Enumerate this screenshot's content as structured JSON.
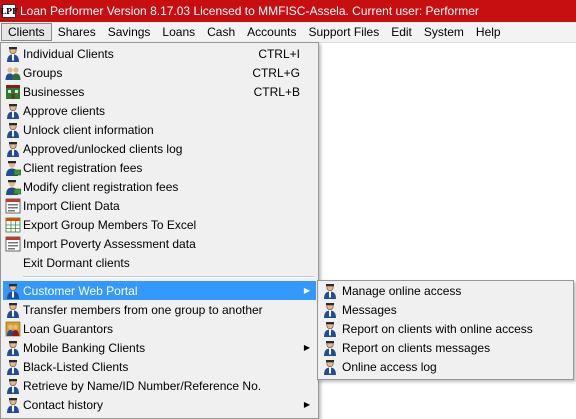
{
  "window": {
    "title": "Loan Performer Version 8.17.03 Licensed to MMFISC-Assela.    Current user: Performer",
    "icon_text": "LPF"
  },
  "menubar": {
    "items": [
      "Clients",
      "Shares",
      "Savings",
      "Loans",
      "Cash",
      "Accounts",
      "Support Files",
      "Edit",
      "System",
      "Help"
    ]
  },
  "clients_menu": {
    "items": [
      {
        "label": "Individual Clients",
        "shortcut": "CTRL+I",
        "icon": "person-icon"
      },
      {
        "label": "Groups",
        "shortcut": "CTRL+G",
        "icon": "group-icon"
      },
      {
        "label": "Businesses",
        "shortcut": "CTRL+B",
        "icon": "business-icon"
      },
      {
        "label": "Approve clients",
        "icon": "person-icon"
      },
      {
        "label": "Unlock client information",
        "icon": "person-icon"
      },
      {
        "label": "Approved/unlocked clients log",
        "icon": "person-icon"
      },
      {
        "label": "Client registration fees",
        "icon": "person-money-icon"
      },
      {
        "label": "Modify client registration fees",
        "icon": "person-money-icon"
      },
      {
        "label": "Import Client Data",
        "icon": "import-icon"
      },
      {
        "label": "Export Group Members To Excel",
        "icon": "excel-icon"
      },
      {
        "label": "Import Poverty Assessment data",
        "icon": "import-icon"
      },
      {
        "label": "Exit Dormant clients",
        "icon": ""
      },
      {
        "label": "Customer Web Portal",
        "icon": "person-icon",
        "submenu": true,
        "highlighted": true
      },
      {
        "label": "Transfer members from one group to another",
        "icon": "person-icon"
      },
      {
        "label": "Loan Guarantors",
        "icon": "guarantor-icon"
      },
      {
        "label": "Mobile Banking Clients",
        "icon": "person-icon",
        "submenu": true
      },
      {
        "label": "Black-Listed Clients",
        "icon": "person-icon"
      },
      {
        "label": "Retrieve by Name/ID Number/Reference No.",
        "icon": "person-icon"
      },
      {
        "label": "Contact history",
        "icon": "person-icon",
        "submenu": true
      }
    ]
  },
  "web_portal_submenu": {
    "items": [
      {
        "label": "Manage online access",
        "icon": "person-icon"
      },
      {
        "label": "Messages",
        "icon": "person-icon"
      },
      {
        "label": "Report on clients with online access",
        "icon": "person-icon"
      },
      {
        "label": "Report on clients messages",
        "icon": "person-icon"
      },
      {
        "label": "Online access log",
        "icon": "person-icon"
      }
    ]
  },
  "colors": {
    "titlebar": "#c70f12",
    "highlight": "#3399ff",
    "menu_bg": "#f0f0f0"
  }
}
